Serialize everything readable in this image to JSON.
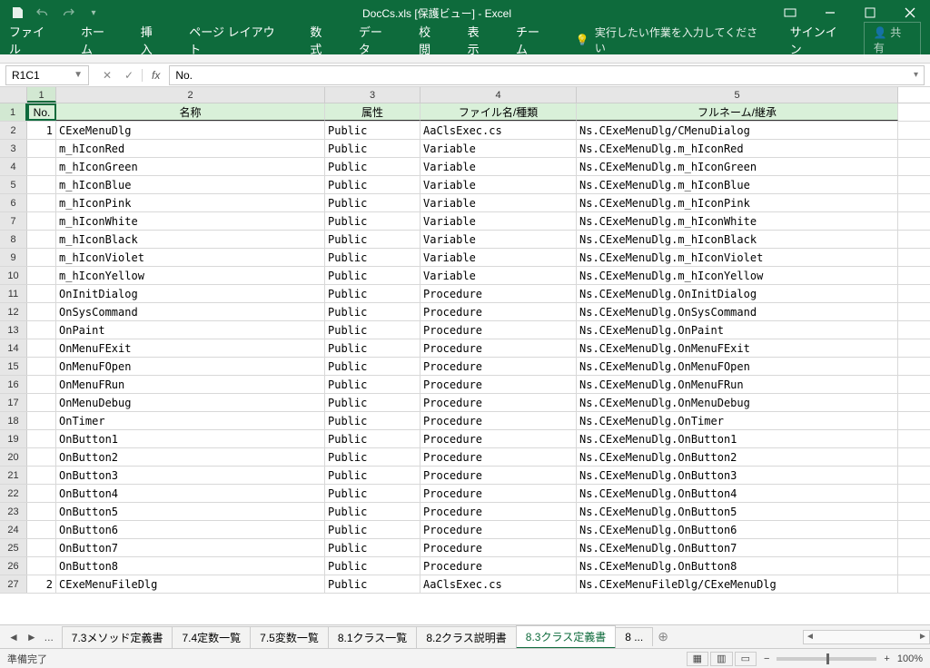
{
  "title": "DocCs.xls  [保護ビュー] - Excel",
  "ribbon": {
    "file": "ファイル",
    "home": "ホーム",
    "insert": "挿入",
    "layout": "ページ レイアウト",
    "formulas": "数式",
    "data": "データ",
    "review": "校閲",
    "view": "表示",
    "team": "チーム",
    "tellme": "実行したい作業を入力してください",
    "signin": "サインイン",
    "share": "共有"
  },
  "fx": {
    "namebox": "R1C1",
    "formula": "No."
  },
  "cols": [
    "1",
    "2",
    "3",
    "4",
    "5"
  ],
  "headers": {
    "c1": "No.",
    "c2": "名称",
    "c3": "属性",
    "c4": "ファイル名/種類",
    "c5": "フルネーム/継承"
  },
  "rows": [
    {
      "n": "1",
      "c1": "1",
      "c2": "CExeMenuDlg",
      "c3": "Public",
      "c4": "AaClsExec.cs",
      "c5": "Ns.CExeMenuDlg/CMenuDialog"
    },
    {
      "n": "2",
      "c1": "",
      "c2": "m_hIconRed",
      "c3": "Public",
      "c4": "Variable",
      "c5": "Ns.CExeMenuDlg.m_hIconRed"
    },
    {
      "n": "3",
      "c1": "",
      "c2": "m_hIconGreen",
      "c3": "Public",
      "c4": "Variable",
      "c5": "Ns.CExeMenuDlg.m_hIconGreen"
    },
    {
      "n": "4",
      "c1": "",
      "c2": "m_hIconBlue",
      "c3": "Public",
      "c4": "Variable",
      "c5": "Ns.CExeMenuDlg.m_hIconBlue"
    },
    {
      "n": "5",
      "c1": "",
      "c2": "m_hIconPink",
      "c3": "Public",
      "c4": "Variable",
      "c5": "Ns.CExeMenuDlg.m_hIconPink"
    },
    {
      "n": "6",
      "c1": "",
      "c2": "m_hIconWhite",
      "c3": "Public",
      "c4": "Variable",
      "c5": "Ns.CExeMenuDlg.m_hIconWhite"
    },
    {
      "n": "7",
      "c1": "",
      "c2": "m_hIconBlack",
      "c3": "Public",
      "c4": "Variable",
      "c5": "Ns.CExeMenuDlg.m_hIconBlack"
    },
    {
      "n": "8",
      "c1": "",
      "c2": "m_hIconViolet",
      "c3": "Public",
      "c4": "Variable",
      "c5": "Ns.CExeMenuDlg.m_hIconViolet"
    },
    {
      "n": "9",
      "c1": "",
      "c2": "m_hIconYellow",
      "c3": "Public",
      "c4": "Variable",
      "c5": "Ns.CExeMenuDlg.m_hIconYellow"
    },
    {
      "n": "10",
      "c1": "",
      "c2": "OnInitDialog",
      "c3": "Public",
      "c4": "Procedure",
      "c5": "Ns.CExeMenuDlg.OnInitDialog"
    },
    {
      "n": "11",
      "c1": "",
      "c2": "OnSysCommand",
      "c3": "Public",
      "c4": "Procedure",
      "c5": "Ns.CExeMenuDlg.OnSysCommand"
    },
    {
      "n": "12",
      "c1": "",
      "c2": "OnPaint",
      "c3": "Public",
      "c4": "Procedure",
      "c5": "Ns.CExeMenuDlg.OnPaint"
    },
    {
      "n": "13",
      "c1": "",
      "c2": "OnMenuFExit",
      "c3": "Public",
      "c4": "Procedure",
      "c5": "Ns.CExeMenuDlg.OnMenuFExit"
    },
    {
      "n": "14",
      "c1": "",
      "c2": "OnMenuFOpen",
      "c3": "Public",
      "c4": "Procedure",
      "c5": "Ns.CExeMenuDlg.OnMenuFOpen"
    },
    {
      "n": "15",
      "c1": "",
      "c2": "OnMenuFRun",
      "c3": "Public",
      "c4": "Procedure",
      "c5": "Ns.CExeMenuDlg.OnMenuFRun"
    },
    {
      "n": "16",
      "c1": "",
      "c2": "OnMenuDebug",
      "c3": "Public",
      "c4": "Procedure",
      "c5": "Ns.CExeMenuDlg.OnMenuDebug"
    },
    {
      "n": "17",
      "c1": "",
      "c2": "OnTimer",
      "c3": "Public",
      "c4": "Procedure",
      "c5": "Ns.CExeMenuDlg.OnTimer"
    },
    {
      "n": "18",
      "c1": "",
      "c2": "OnButton1",
      "c3": "Public",
      "c4": "Procedure",
      "c5": "Ns.CExeMenuDlg.OnButton1"
    },
    {
      "n": "19",
      "c1": "",
      "c2": "OnButton2",
      "c3": "Public",
      "c4": "Procedure",
      "c5": "Ns.CExeMenuDlg.OnButton2"
    },
    {
      "n": "20",
      "c1": "",
      "c2": "OnButton3",
      "c3": "Public",
      "c4": "Procedure",
      "c5": "Ns.CExeMenuDlg.OnButton3"
    },
    {
      "n": "21",
      "c1": "",
      "c2": "OnButton4",
      "c3": "Public",
      "c4": "Procedure",
      "c5": "Ns.CExeMenuDlg.OnButton4"
    },
    {
      "n": "22",
      "c1": "",
      "c2": "OnButton5",
      "c3": "Public",
      "c4": "Procedure",
      "c5": "Ns.CExeMenuDlg.OnButton5"
    },
    {
      "n": "23",
      "c1": "",
      "c2": "OnButton6",
      "c3": "Public",
      "c4": "Procedure",
      "c5": "Ns.CExeMenuDlg.OnButton6"
    },
    {
      "n": "24",
      "c1": "",
      "c2": "OnButton7",
      "c3": "Public",
      "c4": "Procedure",
      "c5": "Ns.CExeMenuDlg.OnButton7"
    },
    {
      "n": "25",
      "c1": "",
      "c2": "OnButton8",
      "c3": "Public",
      "c4": "Procedure",
      "c5": "Ns.CExeMenuDlg.OnButton8"
    },
    {
      "n": "26",
      "c1": "2",
      "c2": "CExeMenuFileDlg",
      "c3": "Public",
      "c4": "AaClsExec.cs",
      "c5": "Ns.CExeMenuFileDlg/CExeMenuDlg"
    }
  ],
  "sheets": {
    "nav_more": "...",
    "t1": "7.3メソッド定義書",
    "t2": "7.4定数一覧",
    "t3": "7.5変数一覧",
    "t4": "8.1クラス一覧",
    "t5": "8.2クラス説明書",
    "t6": "8.3クラス定義書",
    "t7": "8 ..."
  },
  "status": {
    "ready": "準備完了",
    "zoom": "100%"
  }
}
